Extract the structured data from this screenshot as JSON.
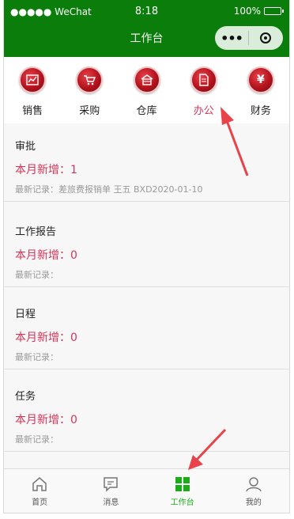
{
  "status_bar": {
    "carrier": "●●●●● WeChat",
    "time": "8:18",
    "battery": "100%"
  },
  "header": {
    "title": "工作台",
    "more_icon": "more-dots-icon",
    "close_icon": "target-close-icon"
  },
  "quick_menu": [
    {
      "label": "销售",
      "icon": "sales-chart-icon",
      "glyph": "⌇"
    },
    {
      "label": "采购",
      "icon": "shopping-cart-icon",
      "glyph": "⛟"
    },
    {
      "label": "仓库",
      "icon": "warehouse-icon",
      "glyph": "⌂"
    },
    {
      "label": "办公",
      "icon": "office-document-icon",
      "glyph": "▤"
    },
    {
      "label": "财务",
      "icon": "finance-yuan-icon",
      "glyph": "¥"
    }
  ],
  "sections": [
    {
      "title": "审批",
      "count": "本月新增：1",
      "recent": "最新记录：差旅费报销单 王五 BXD2020-01-10"
    },
    {
      "title": "工作报告",
      "count": "本月新增：0",
      "recent": "最新记录："
    },
    {
      "title": "日程",
      "count": "本月新增：0",
      "recent": "最新记录："
    },
    {
      "title": "任务",
      "count": "本月新增：0",
      "recent": "最新记录："
    }
  ],
  "tabbar": [
    {
      "label": "首页",
      "icon": "home-icon"
    },
    {
      "label": "消息",
      "icon": "message-icon"
    },
    {
      "label": "工作台",
      "icon": "workbench-grid-icon"
    },
    {
      "label": "我的",
      "icon": "profile-icon"
    }
  ],
  "colors": {
    "header_bg": "#0a7d0a",
    "accent_red": "#d4365a",
    "tab_active": "#1aad19",
    "annotation": "#e8434a"
  }
}
